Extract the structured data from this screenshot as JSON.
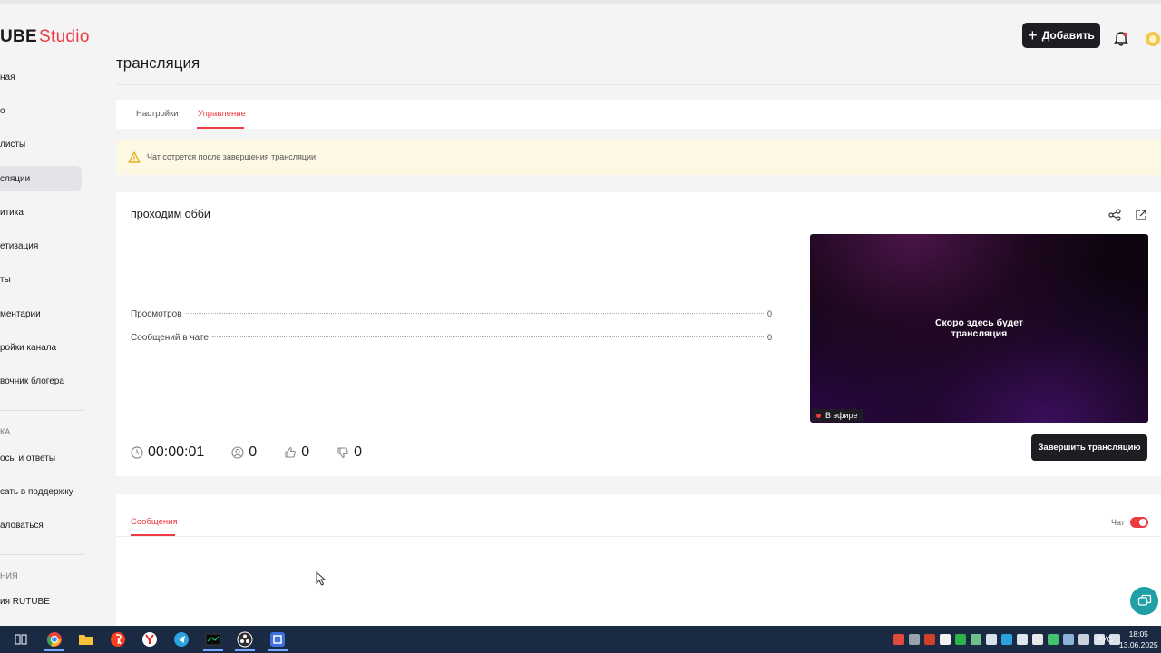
{
  "header": {
    "logo_left": "UBE",
    "logo_right": "Studio",
    "add_label": "Добавить"
  },
  "sidebar": {
    "items": [
      {
        "label": "ная",
        "active": false
      },
      {
        "label": "о",
        "active": false
      },
      {
        "label": "листы",
        "active": false
      },
      {
        "label": "сляции",
        "active": true
      },
      {
        "label": "итика",
        "active": false
      },
      {
        "label": "етизация",
        "active": false
      },
      {
        "label": "ты",
        "active": false
      },
      {
        "label": "ментарии",
        "active": false
      },
      {
        "label": "ройки канала",
        "active": false
      },
      {
        "label": "вочник блогера",
        "active": false
      }
    ],
    "section1": "КА",
    "items2": [
      {
        "label": "осы и ответы"
      },
      {
        "label": "сать в поддержку"
      },
      {
        "label": "аловаться"
      }
    ],
    "section2": "НИЯ",
    "items3": [
      {
        "label": "ия RUTUBE"
      }
    ]
  },
  "page": {
    "title": "трансляция"
  },
  "tabs": [
    {
      "label": "Настройки",
      "active": false
    },
    {
      "label": "Управление",
      "active": true
    }
  ],
  "notice": {
    "text": "Чат сотрется после завершения трансляции"
  },
  "stream": {
    "name": "проходим обби",
    "stats": [
      {
        "label": "Просмотров",
        "value": "0"
      },
      {
        "label": "Сообщений в чате",
        "value": "0"
      }
    ],
    "timer": "00:00:01",
    "viewers": "0",
    "likes": "0",
    "dislikes": "0",
    "preview_line1": "Скоро здесь будет",
    "preview_line2": "трансляция",
    "live_label": "В эфире",
    "end_label": "Завершить трансляцию"
  },
  "chat": {
    "tab_label": "Сообщения",
    "toggle_label": "Чат",
    "toggle_on": true
  },
  "taskbar": {
    "lang": "РУС",
    "time": "18:05",
    "date": "13.06.2025"
  },
  "colors": {
    "accent": "#ed3b43",
    "dark_button": "#1d1e22",
    "notice_bg": "#fdf8e4",
    "taskbar": "#1b2a43"
  }
}
